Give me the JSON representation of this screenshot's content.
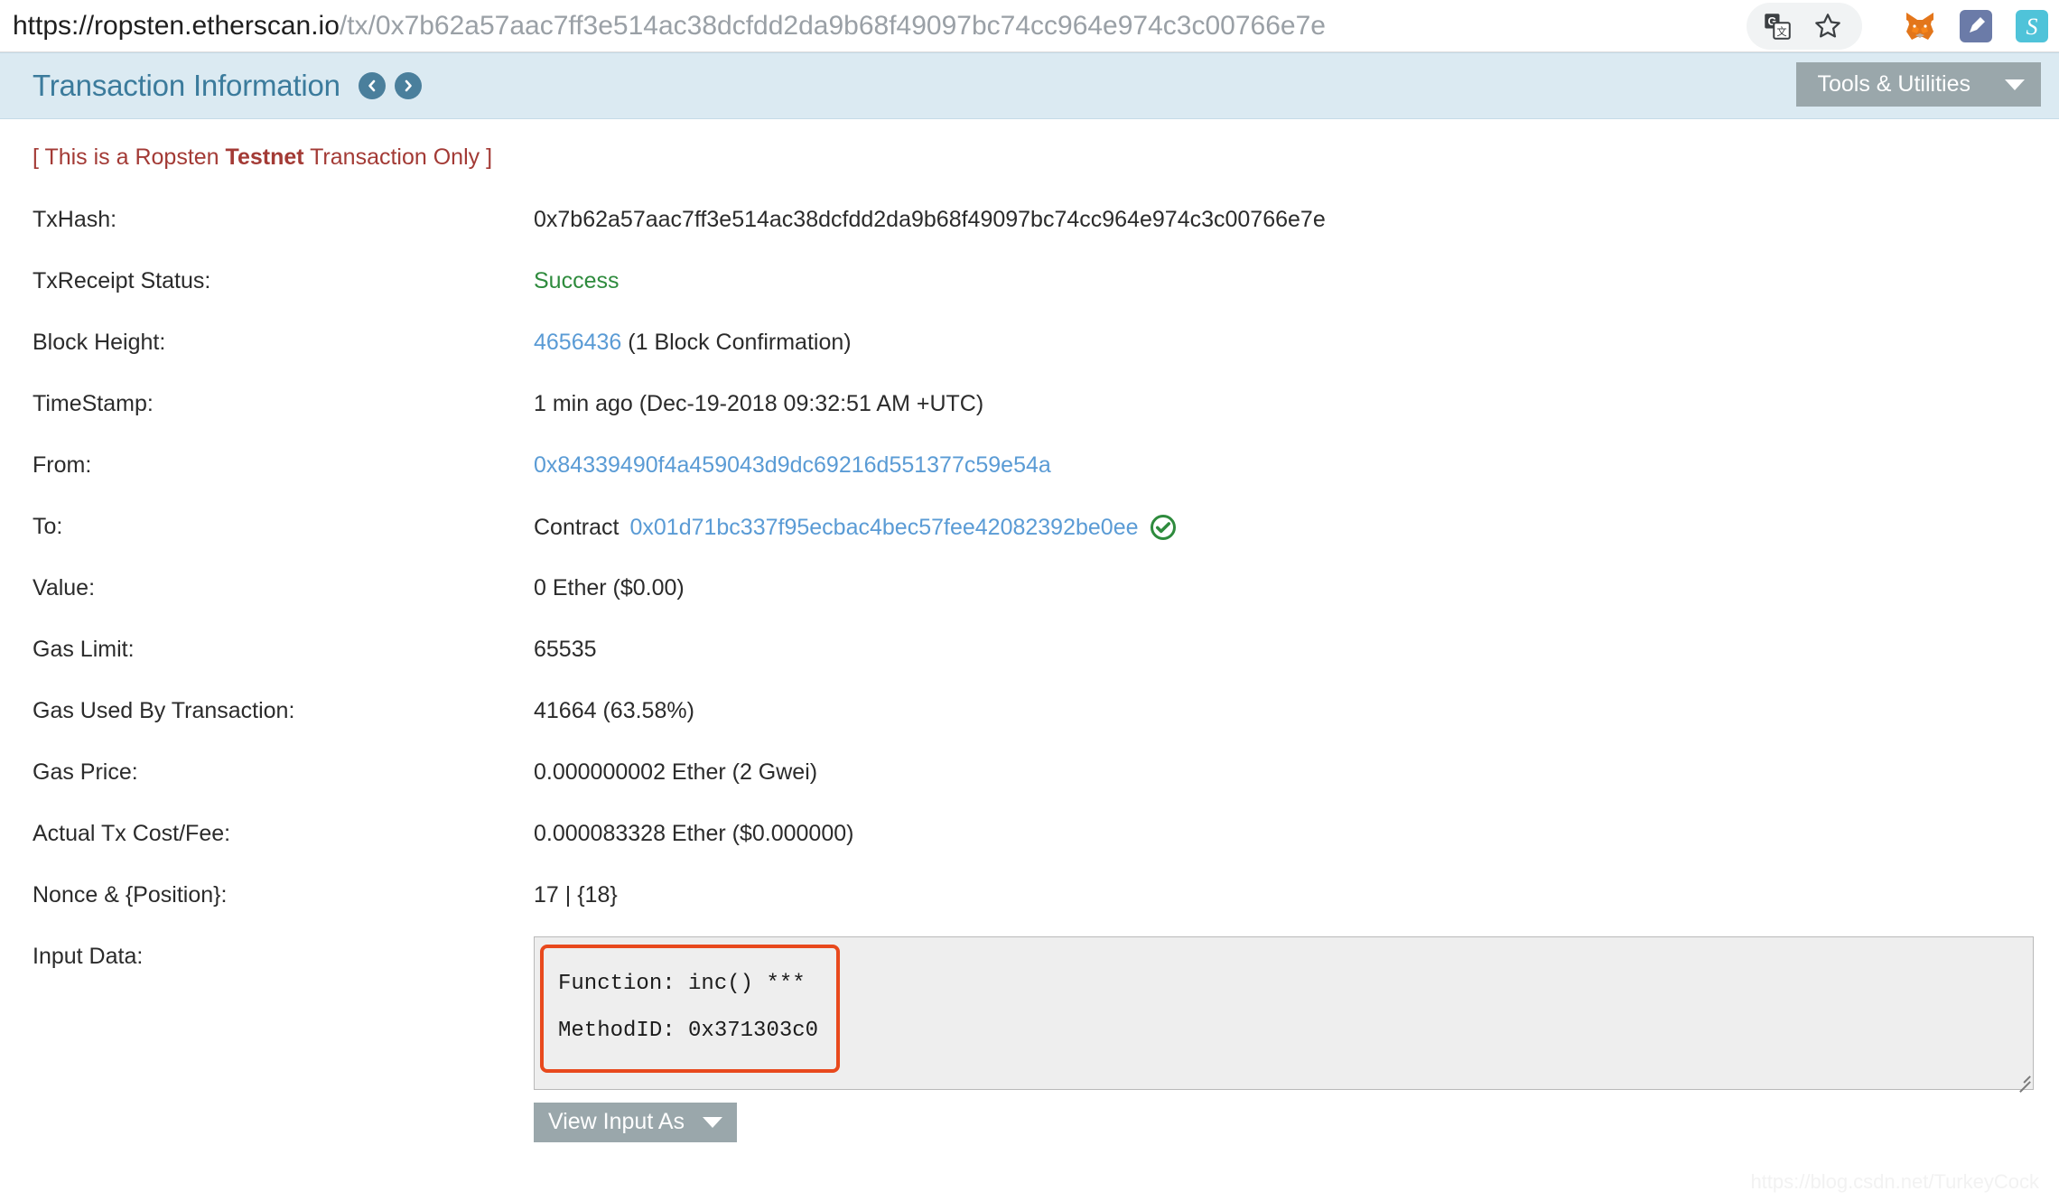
{
  "browser": {
    "url_domain": "https://ropsten.etherscan.io",
    "url_path": "/tx/0x7b62a57aac7ff3e514ac38dcfdd2da9b68f49097bc74cc964e974c3c00766e7e",
    "icons": {
      "translate": "translate-icon",
      "bookmark": "bookmark-star-icon",
      "metamask": "metamask-fox-icon",
      "pen": "pen-extension-icon",
      "s_ext": "s-extension-icon"
    }
  },
  "header": {
    "title": "Transaction Information",
    "prev_label": "Previous transaction",
    "next_label": "Next transaction",
    "tools_label": "Tools & Utilities"
  },
  "notice": {
    "prefix": "[ This is a Ropsten ",
    "emphasis": "Testnet",
    "suffix": " Transaction Only ]"
  },
  "transaction": {
    "txhash": {
      "label": "TxHash:",
      "value": "0x7b62a57aac7ff3e514ac38dcfdd2da9b68f49097bc74cc964e974c3c00766e7e"
    },
    "receipt_status": {
      "label": "TxReceipt Status:",
      "value": "Success"
    },
    "block_height": {
      "label": "Block Height:",
      "value": "4656436",
      "confirmations": "(1 Block Confirmation)"
    },
    "timestamp": {
      "label": "TimeStamp:",
      "value": "1 min ago (Dec-19-2018 09:32:51 AM +UTC)"
    },
    "from": {
      "label": "From:",
      "value": "0x84339490f4a459043d9dc69216d551377c59e54a"
    },
    "to": {
      "label": "To:",
      "prefix": "Contract",
      "value": "0x01d71bc337f95ecbac4bec57fee42082392be0ee",
      "verified": "contract-verified-check-icon"
    },
    "value": {
      "label": "Value:",
      "value": "0 Ether ($0.00)"
    },
    "gas_limit": {
      "label": "Gas Limit:",
      "value": "65535"
    },
    "gas_used": {
      "label": "Gas Used By Transaction:",
      "value": "41664 (63.58%)"
    },
    "gas_price": {
      "label": "Gas Price:",
      "value": "0.000000002 Ether (2 Gwei)"
    },
    "tx_cost": {
      "label": "Actual Tx Cost/Fee:",
      "value": "0.000083328 Ether ($0.000000)"
    },
    "nonce": {
      "label": "Nonce & {Position}:",
      "value": "17 | {18}"
    },
    "input_data": {
      "label": "Input Data:",
      "function_line": "Function: inc() ***",
      "method_line": "MethodID: 0x371303c0",
      "view_as_label": "View Input As"
    }
  },
  "watermark": "https://blog.csdn.net/TurkeyCock",
  "colors": {
    "header_band": "#dbeaf2",
    "title_text": "#3b7b9c",
    "link": "#5a9bd5",
    "success": "#2e8b3d",
    "testnet_warning": "#a33a35",
    "button_gray": "#9aa7ab",
    "highlight_box": "#e8491d",
    "verified_green": "#2e8b3d"
  }
}
